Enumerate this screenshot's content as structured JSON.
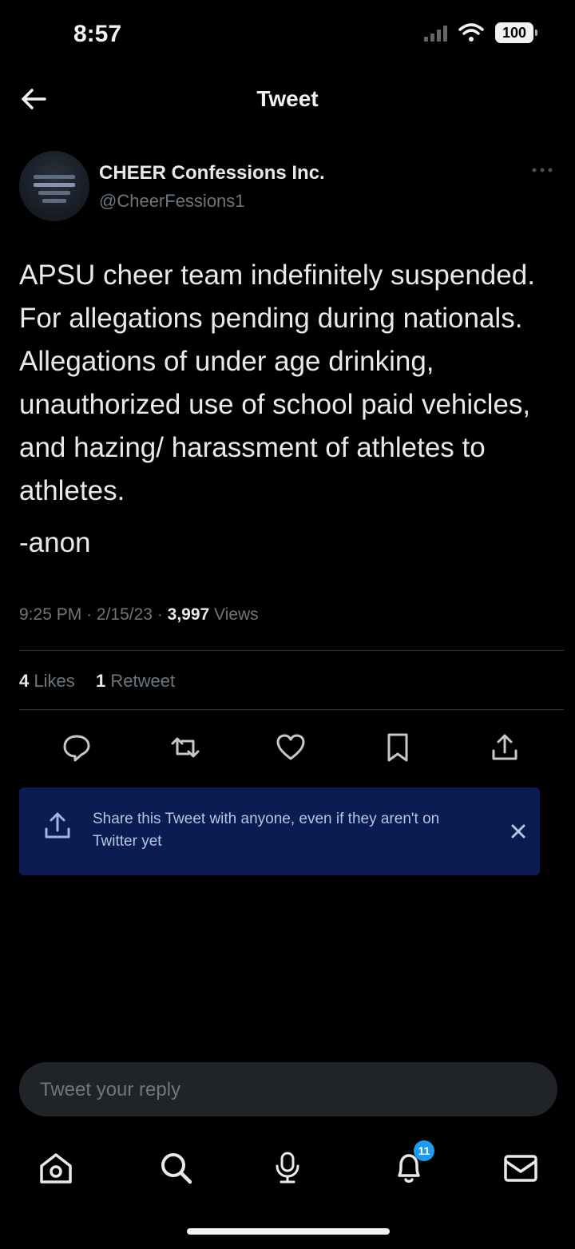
{
  "status_bar": {
    "time": "8:57",
    "battery": "100"
  },
  "header": {
    "title": "Tweet"
  },
  "tweet": {
    "author_name": "CHEER Confessions Inc.",
    "author_handle": "@CheerFessions1",
    "text": "APSU cheer team indefinitely suspended. For allegations pending during nationals. Allegations of under age drinking, unauthorized use of school paid vehicles, and hazing/ harassment of athletes to athletes.",
    "signoff": "-anon",
    "time": "9:25 PM",
    "date": "2/15/23",
    "views_count": "3,997",
    "views_label": "Views",
    "likes_count": "4",
    "likes_label": "Likes",
    "retweets_count": "1",
    "retweets_label": "Retweet"
  },
  "actions": [
    {
      "icon": "reply-icon"
    },
    {
      "icon": "retweet-icon"
    },
    {
      "icon": "like-icon"
    },
    {
      "icon": "bookmark-icon"
    },
    {
      "icon": "share-icon"
    }
  ],
  "share_banner": {
    "text": "Share this Tweet with anyone, even if they aren't on Twitter yet"
  },
  "reply": {
    "placeholder": "Tweet your reply"
  },
  "tab_bar": {
    "notifications_badge": "11"
  },
  "colors": {
    "background": "#000000",
    "text": "#e7e9ea",
    "secondary_text": "#6e767d",
    "accent": "#1d9bf0",
    "banner_bg": "#0a1c52"
  }
}
